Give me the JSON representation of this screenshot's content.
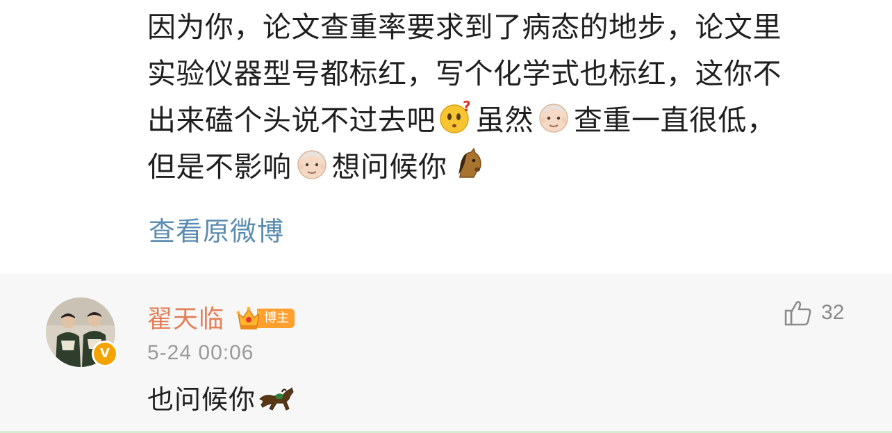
{
  "post": {
    "lines": [
      "因为你，论文查重率要求到了病态的地步，论文里",
      "实验仪器型号都标红，写个化学式也标红，这你不"
    ],
    "line3_a": "出来磕个头说不过去吧",
    "line3_b": "虽然",
    "line3_c": "查重一直很低，",
    "line4_a": "但是不影响",
    "line4_b": "想问候你",
    "emojis": [
      "thinking-face-icon",
      "old-man-icon",
      "old-man-icon",
      "horse-face-icon"
    ],
    "view_original": "查看原微博"
  },
  "comment": {
    "username": "翟天临",
    "badge": "博主",
    "timestamp": "5-24 00:06",
    "text": "也问候你",
    "like_count": "32",
    "colors": {
      "username": "#e2805a",
      "badge": "#ff9f2e",
      "link": "#5a8bb0",
      "verified": "#f5a300"
    }
  }
}
